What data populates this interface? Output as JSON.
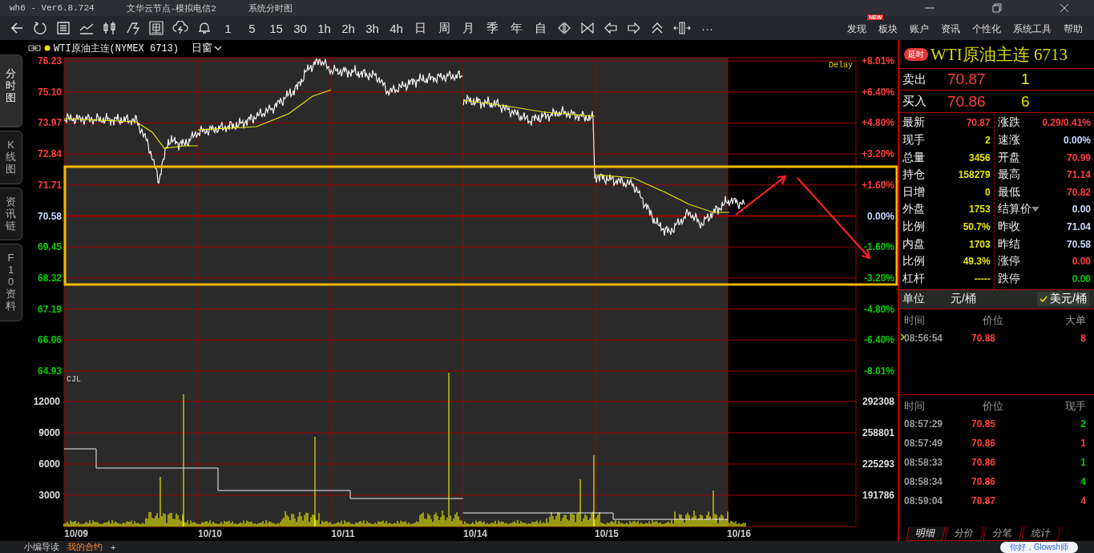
{
  "title_bar": {
    "app": "wh6 - Ver6.8.724",
    "server": "文华云节点-模拟电信2",
    "view": "系统分时图"
  },
  "toolbar": {
    "periods": [
      "1",
      "5",
      "15",
      "30",
      "1h",
      "2h",
      "3h",
      "4h",
      "日",
      "周",
      "月",
      "季",
      "年",
      "自"
    ],
    "more": "···",
    "menu": [
      {
        "label": "发现",
        "badge": "NEW"
      },
      {
        "label": "板块"
      },
      {
        "label": "账户"
      },
      {
        "label": "资讯"
      },
      {
        "label": "个性化"
      },
      {
        "label": "系统工具"
      },
      {
        "label": "帮助"
      }
    ]
  },
  "side_tabs": [
    {
      "label": "分时图",
      "selected": true
    },
    {
      "label": "K线图",
      "selected": false
    },
    {
      "label": "资讯链",
      "selected": false
    },
    {
      "label": "F10资料",
      "selected": false
    }
  ],
  "chart": {
    "contract": "WTI原油主连(NYMEX 6713)",
    "window": "日窗",
    "delay": "Delay",
    "volume_label": "CJL",
    "price_ticks": [
      {
        "label": "76.23",
        "kind": "up"
      },
      {
        "label": "75.10",
        "kind": "up"
      },
      {
        "label": "73.97",
        "kind": "up"
      },
      {
        "label": "72.84",
        "kind": "up"
      },
      {
        "label": "71.71",
        "kind": "up"
      },
      {
        "label": "70.58",
        "kind": "flat"
      },
      {
        "label": "69.45",
        "kind": "down"
      },
      {
        "label": "68.32",
        "kind": "down"
      },
      {
        "label": "67.19",
        "kind": "down"
      },
      {
        "label": "66.06",
        "kind": "down"
      },
      {
        "label": "64.93",
        "kind": "down"
      }
    ],
    "percent_ticks": [
      {
        "label": "+8.01%",
        "kind": "up"
      },
      {
        "label": "+6.40%",
        "kind": "up"
      },
      {
        "label": "+4.80%",
        "kind": "up"
      },
      {
        "label": "+3.20%",
        "kind": "up"
      },
      {
        "label": "+1.60%",
        "kind": "up"
      },
      {
        "label": "0.00%",
        "kind": "flat"
      },
      {
        "label": "-1.60%",
        "kind": "down"
      },
      {
        "label": "-3.20%",
        "kind": "down"
      },
      {
        "label": "-4.80%",
        "kind": "down"
      },
      {
        "label": "-6.40%",
        "kind": "down"
      },
      {
        "label": "-8.01%",
        "kind": "down"
      }
    ],
    "volume_ticks": [
      "12000",
      "9000",
      "6000",
      "3000"
    ],
    "interest_ticks": [
      "292308",
      "258801",
      "225293",
      "191786"
    ],
    "dates": [
      "10/09",
      "10/10",
      "10/11",
      "10/14",
      "10/15",
      "10/16"
    ]
  },
  "quote": {
    "badge": "延时",
    "title": "WTI原油主连 6713",
    "ask": {
      "label": "卖出",
      "price": "70.87",
      "qty": "1"
    },
    "bid": {
      "label": "买入",
      "price": "70.86",
      "qty": "6"
    },
    "stats_left": [
      {
        "label": "最新",
        "value": "70.87",
        "kind": "up"
      },
      {
        "label": "现手",
        "value": "2",
        "kind": "vol"
      },
      {
        "label": "总量",
        "value": "3456",
        "kind": "vol"
      },
      {
        "label": "持仓",
        "value": "158279",
        "kind": "vol"
      },
      {
        "label": "日增",
        "value": "0",
        "kind": "vol"
      },
      {
        "label": "外盘",
        "value": "1753",
        "kind": "vol"
      },
      {
        "label": "比例",
        "value": "50.7%",
        "kind": "vol"
      },
      {
        "label": "内盘",
        "value": "1703",
        "kind": "vol"
      },
      {
        "label": "比例",
        "value": "49.3%",
        "kind": "vol"
      },
      {
        "label": "杠杆",
        "value": "-----",
        "kind": "vol"
      }
    ],
    "stats_right": [
      {
        "label": "涨跌",
        "value": "0.29/0.41%",
        "kind": "up"
      },
      {
        "label": "速涨",
        "value": "0.00%",
        "kind": "flat"
      },
      {
        "label": "开盘",
        "value": "70.99",
        "kind": "up"
      },
      {
        "label": "最高",
        "value": "71.14",
        "kind": "up"
      },
      {
        "label": "最低",
        "value": "70.82",
        "kind": "up"
      },
      {
        "label": "结算价",
        "value": "0.00",
        "kind": "flat",
        "dropdown": true
      },
      {
        "label": "昨收",
        "value": "71.04",
        "kind": "flat"
      },
      {
        "label": "昨结",
        "value": "70.58",
        "kind": "flat"
      },
      {
        "label": "涨停",
        "value": "0.00",
        "kind": "up"
      },
      {
        "label": "跌停",
        "value": "0.00",
        "kind": "down"
      }
    ],
    "unit": {
      "label": "单位",
      "options": [
        {
          "label": "元/桶",
          "selected": false
        },
        {
          "label": "美元/桶",
          "selected": true
        }
      ]
    },
    "big_orders": {
      "columns": [
        "时间",
        "价位",
        "大单"
      ],
      "rows": [
        {
          "time": "08:56:54",
          "price": "70.88",
          "size": "8",
          "kind": "up"
        }
      ]
    },
    "ticks": {
      "columns": [
        "时间",
        "价位",
        "现手"
      ],
      "rows": [
        {
          "time": "08:57:29",
          "price": "70.85",
          "size": "2",
          "kind": "down"
        },
        {
          "time": "08:57:49",
          "price": "70.86",
          "size": "1",
          "kind": "up"
        },
        {
          "time": "08:58:33",
          "price": "70.86",
          "size": "1",
          "kind": "down"
        },
        {
          "time": "08:58:34",
          "price": "70.86",
          "size": "4",
          "kind": "down"
        },
        {
          "time": "08:59:04",
          "price": "70.87",
          "size": "4",
          "kind": "up"
        }
      ]
    },
    "tabs": [
      {
        "label": "明细",
        "selected": true
      },
      {
        "label": "分价",
        "selected": false
      },
      {
        "label": "分笔",
        "selected": false
      },
      {
        "label": "统计",
        "selected": false
      }
    ]
  },
  "bottom_tabs": [
    {
      "label": "小编导读",
      "selected": false
    },
    {
      "label": "我的合约",
      "selected": true
    }
  ],
  "add_tab": "+",
  "assistant": "你好，Glowsh师"
}
